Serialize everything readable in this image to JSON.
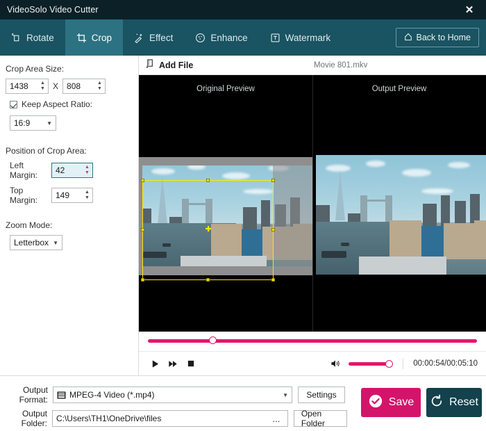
{
  "window": {
    "title": "VideoSolo Video Cutter",
    "close_icon": "close-icon"
  },
  "tabs": [
    {
      "label": "Rotate",
      "icon": "rotate-icon",
      "active": false
    },
    {
      "label": "Crop",
      "icon": "crop-icon",
      "active": true
    },
    {
      "label": "Effect",
      "icon": "effect-icon",
      "active": false
    },
    {
      "label": "Enhance",
      "icon": "enhance-icon",
      "active": false
    },
    {
      "label": "Watermark",
      "icon": "watermark-icon",
      "active": false
    }
  ],
  "back_home": {
    "label": "Back to Home",
    "icon": "home-icon"
  },
  "sidebar": {
    "crop_area_size_label": "Crop Area Size:",
    "crop_width": "1438",
    "crop_size_separator": "X",
    "crop_height": "808",
    "keep_aspect_ratio_label": "Keep Aspect Ratio:",
    "keep_aspect_ratio_checked": true,
    "aspect_ratio_value": "16:9",
    "position_label": "Position of Crop Area:",
    "left_margin_label": "Left Margin:",
    "left_margin_value": "42",
    "top_margin_label": "Top Margin:",
    "top_margin_value": "149",
    "zoom_mode_label": "Zoom Mode:",
    "zoom_mode_value": "Letterbox"
  },
  "preview": {
    "add_file_label": "Add File",
    "add_file_icon": "add-file-icon",
    "filename": "Movie 801.mkv",
    "original_pane_title": "Original Preview",
    "output_pane_title": "Output Preview"
  },
  "transport": {
    "play_icon": "play-icon",
    "forward_icon": "fast-forward-icon",
    "stop_icon": "stop-icon",
    "volume_icon": "volume-icon",
    "time": "00:00:54/00:05:10",
    "seek_percent": 19,
    "volume_percent": 100
  },
  "bottom": {
    "output_format_label": "Output Format:",
    "output_format_value": "MPEG-4 Video (*.mp4)",
    "output_format_icon": "film-icon",
    "settings_label": "Settings",
    "output_folder_label": "Output Folder:",
    "output_folder_value": "C:\\Users\\TH1\\OneDrive\\files",
    "browse_label": "...",
    "open_folder_label": "Open Folder",
    "save_label": "Save",
    "save_icon": "check-circle-icon",
    "reset_label": "Reset",
    "reset_icon": "reset-icon"
  },
  "colors": {
    "titlebar": "#0c2127",
    "tabbar": "#1a5361",
    "tab_active": "#2c7282",
    "accent_pink": "#e3176b",
    "save": "#d4146b",
    "reset": "#13414c",
    "crop_outline": "#ffe600"
  }
}
